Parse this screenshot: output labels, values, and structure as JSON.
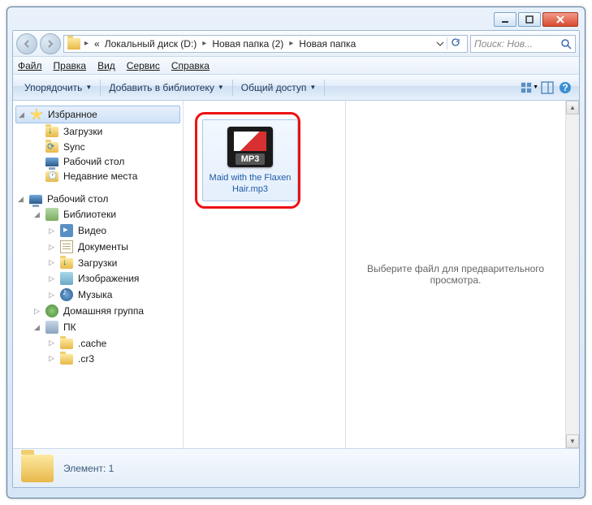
{
  "breadcrumb": {
    "prefix": "«",
    "items": [
      "Локальный диск (D:)",
      "Новая папка (2)",
      "Новая папка"
    ]
  },
  "search": {
    "placeholder": "Поиск: Нов..."
  },
  "menu": {
    "file": "Файл",
    "edit": "Правка",
    "view": "Вид",
    "tools": "Сервис",
    "help": "Справка"
  },
  "toolbar": {
    "organize": "Упорядочить",
    "addlib": "Добавить в библиотеку",
    "share": "Общий доступ"
  },
  "nav": {
    "favorites": "Избранное",
    "downloads": "Загрузки",
    "sync": "Sync",
    "desktop": "Рабочий стол",
    "recent": "Недавние места",
    "desktop2": "Рабочий стол",
    "libraries": "Библиотеки",
    "video": "Видео",
    "documents": "Документы",
    "downloads2": "Загрузки",
    "pictures": "Изображения",
    "music": "Музыка",
    "homegroup": "Домашняя группа",
    "pc": "ПК",
    "cache": ".cache",
    "cr3": ".cr3"
  },
  "file": {
    "name": "Maid with the Flaxen Hair.mp3"
  },
  "preview": {
    "text": "Выберите файл для предварительного просмотра."
  },
  "status": {
    "text": "Элемент: 1"
  }
}
